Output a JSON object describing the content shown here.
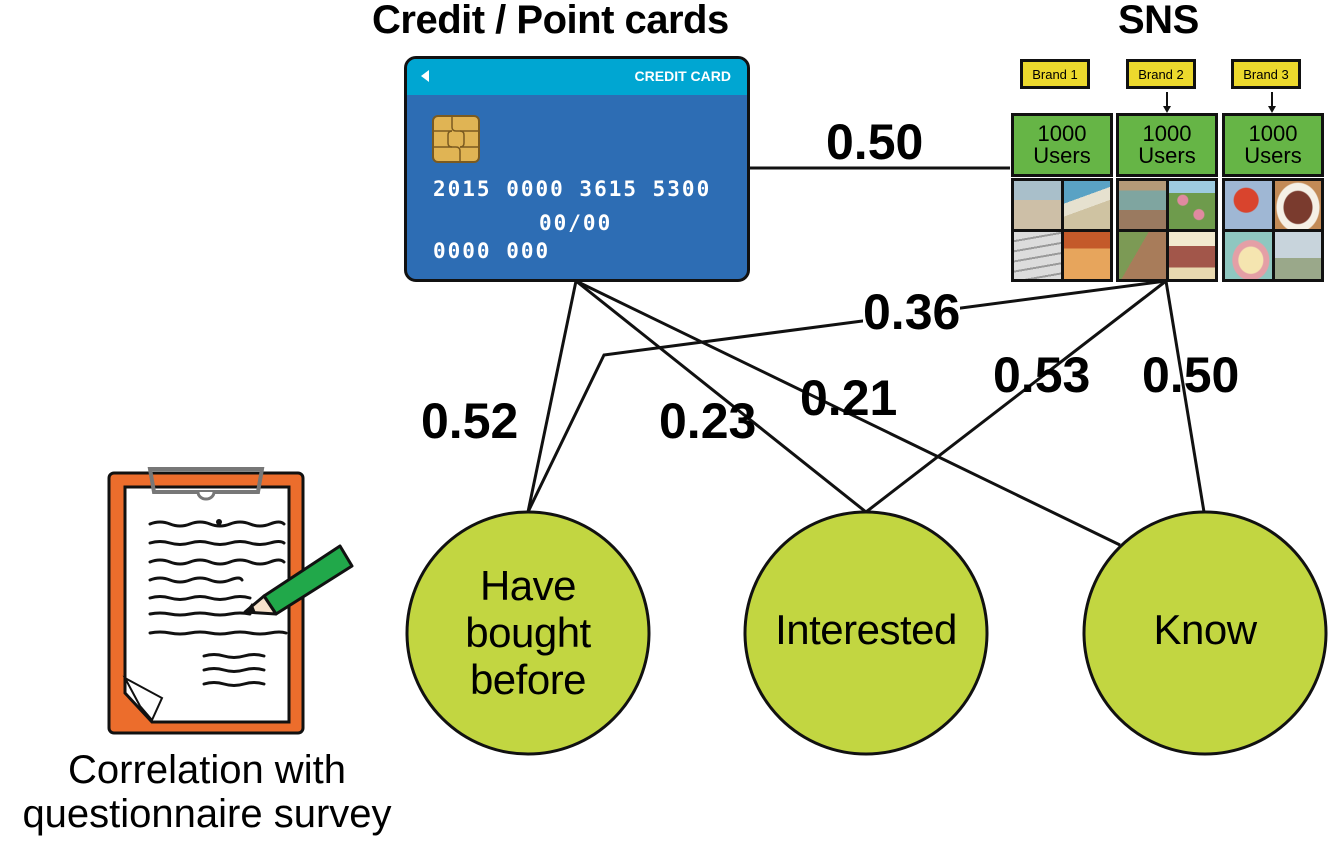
{
  "headings": {
    "card_source": "Credit / Point cards",
    "sns_source": "SNS"
  },
  "credit_card": {
    "band_label": "CREDIT CARD",
    "number": "2015  0000  3615  5300",
    "expiry": "00/00",
    "holder_code": "0000 000",
    "colors": {
      "body": "#2d6db4",
      "band": "#00a6d2",
      "chip": "#e0b454"
    }
  },
  "sns": {
    "brands": [
      {
        "label": "Brand 1",
        "users": [
          "1000",
          "Users"
        ],
        "images": [
          "cat",
          "person-with-dog-on-beach",
          "stacked-bars",
          "hand-with-autumn-leaves"
        ]
      },
      {
        "label": "Brand 2",
        "users": [
          "1000",
          "Users"
        ],
        "images": [
          "books",
          "pink-flowering-bush",
          "girl-walking-path",
          "food-plate"
        ]
      },
      {
        "label": "Brand 3",
        "users": [
          "1000",
          "Users"
        ],
        "images": [
          "red-flower-sky",
          "steak-dish",
          "pastries-and-mug",
          "bird-on-rock"
        ]
      }
    ],
    "colors": {
      "brand_box": "#ecd92d",
      "users_box": "#66b546"
    }
  },
  "nodes": [
    {
      "id": "have-bought-before",
      "label_lines": [
        "Have",
        "bought",
        "before"
      ]
    },
    {
      "id": "interested",
      "label_lines": [
        "Interested"
      ]
    },
    {
      "id": "know",
      "label_lines": [
        "Know"
      ]
    }
  ],
  "node_color": "#c2d641",
  "correlations": [
    {
      "from": "credit-card",
      "to": "sns",
      "value": "0.50"
    },
    {
      "from": "credit-card",
      "to": "have-bought-before",
      "value": "0.52"
    },
    {
      "from": "credit-card",
      "to": "interested",
      "value": "0.23"
    },
    {
      "from": "credit-card",
      "to": "know",
      "value": "0.21"
    },
    {
      "from": "sns",
      "to": "have-bought-before",
      "value": "0.36"
    },
    {
      "from": "sns",
      "to": "interested",
      "value": "0.53"
    },
    {
      "from": "sns",
      "to": "know",
      "value": "0.50"
    }
  ],
  "survey": {
    "caption_lines": [
      "Correlation with",
      "questionnaire survey"
    ],
    "colors": {
      "clipboard": "#ec6d2c",
      "pencil": "#21a84a"
    }
  }
}
